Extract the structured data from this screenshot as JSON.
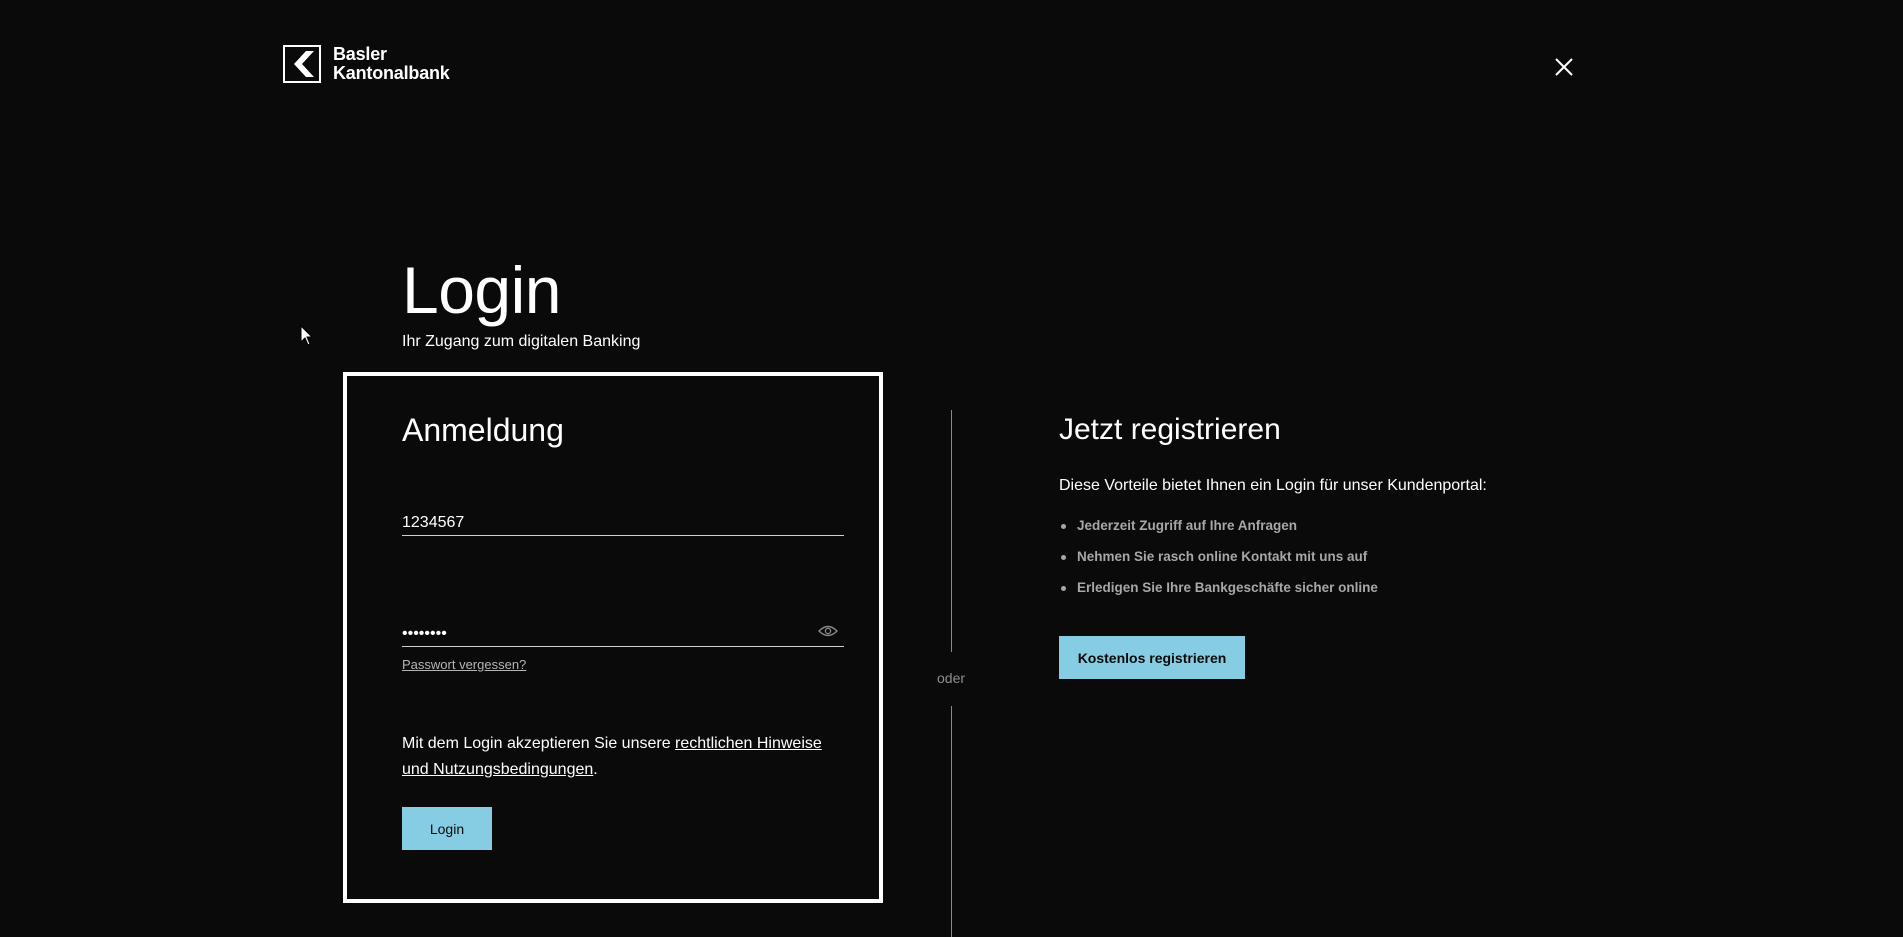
{
  "header": {
    "logo_line1": "Basler",
    "logo_line2": "Kantonalbank"
  },
  "main": {
    "title": "Login",
    "subtitle": "Ihr Zugang zum digitalen Banking"
  },
  "login_card": {
    "heading": "Anmeldung",
    "username_value": "1234567",
    "password_value": "12345678",
    "forgot_password": "Passwort vergessen?",
    "terms_prefix": "Mit dem Login akzeptieren Sie unsere ",
    "terms_link": "rechtlichen Hinweise und Nutzungsbedingungen",
    "terms_suffix": ".",
    "login_button": "Login"
  },
  "divider": {
    "label": "oder"
  },
  "register": {
    "heading": "Jetzt registrieren",
    "intro": "Diese Vorteile bietet Ihnen ein Login für unser Kundenportal:",
    "benefits": [
      "Jederzeit Zugriff auf Ihre Anfragen",
      "Nehmen Sie rasch online Kontakt mit uns auf",
      "Erledigen Sie Ihre Bankgeschäfte sicher online"
    ],
    "register_button": "Kostenlos registrieren"
  },
  "colors": {
    "background": "#0a0a0a",
    "accent": "#86cde3",
    "text": "#ffffff",
    "muted": "#a7a7a7"
  },
  "icons": [
    "bkb-logo-icon",
    "close-icon",
    "eye-icon",
    "mouse-cursor-icon"
  ]
}
